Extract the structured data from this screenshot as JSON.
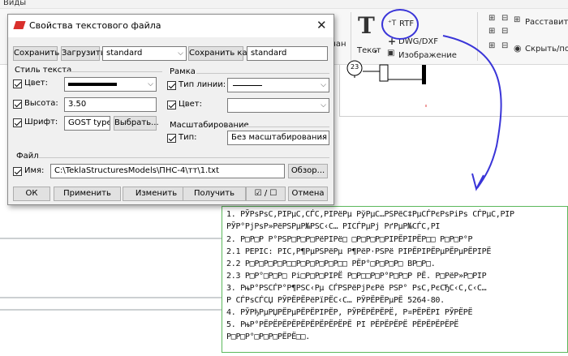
{
  "app": {
    "menu_item": "Виды",
    "ribbon": {
      "text_label_partial": "Текст",
      "chan_label_partial": "чан",
      "rtf_label": "RTF",
      "dwg_label": "DWG/DXF",
      "image_label": "Изображение",
      "arrange_label": "Расставить о",
      "hide_label": "Скрыть/пока",
      "circle_color": "#3a35d8"
    },
    "drawing_label": "23"
  },
  "dialog": {
    "title": "Свойства текстового файла",
    "toolbar": {
      "save_label": "Сохранить",
      "load_label": "Загрузить",
      "preset_value": "standard",
      "save_as_label": "Сохранить как",
      "save_as_value": "standard"
    },
    "text_style": {
      "group_label": "Стиль текста",
      "color_label": "Цвет:",
      "height_label": "Высота:",
      "height_value": "3.50",
      "font_label": "Шрифт:",
      "font_value": "GOST type A",
      "choose_label": "Выбрать..."
    },
    "frame": {
      "group_label": "Рамка",
      "line_type_label": "Тип линии:",
      "color_label": "Цвет:"
    },
    "scaling": {
      "group_label": "Масштабирование",
      "type_label": "Тип:",
      "type_value": "Без масштабирования"
    },
    "file": {
      "group_label": "Файл",
      "name_label": "Имя:",
      "path_value": "C:\\TeklaStructuresModels\\ПНС-4\\тт\\1.txt",
      "browse_label": "Обзор..."
    },
    "buttons": {
      "ok": "ОК",
      "apply": "Применить",
      "modify": "Изменить",
      "get": "Получить",
      "toggle": "☑ / ☐",
      "cancel": "Отмена"
    }
  },
  "text_panel": {
    "lines": [
      "1.  РЎРѕРѕС‚РІРµС‚СЃС‚РІРёРµ РўРµС…РЅРёС‡РµСЃРєРѕРіРѕ СЃРµС‚РІР",
      "    РЎР°РјРѕР»РёРЅРµР№РЅС‹С… РІСЃРµРј РґРµР№СЃС‚РІ",
      "2.  Р□Р□Р Р°РЅР□Р□Р□РёРІРё□ □Р□Р□Р□РІРЁРІРЁР□□ Р□Р□Р°Р",
      "2.1 РЕРІС: РІС‚Р¶РµРЅРёРµ Р¶РёР·РЅРё РІРЁРІРЁРµРЁРµРЁРІРЁ",
      "2.2 Р□Р□Р□Р□Р□□Р□Р□Р□Р□Р□□ РЁР°□Р□Р□Р□ ВР□Р□.",
      "2.3 Р□Р°□Р□Р□ Рі□Р□Р□РІРЁ Р□Р□□Р□Р°Р□Р□Р РЁ. Р□РёР»Р□РІР",
      "3.  РњР°РЅСЃР°Р¶РЅС‹Рµ СЃРЅРёРјРєРё РЅР° РѕС‚РєСЂС‹С‚С‹С…",
      "    Р СЃРѕСЃСЏ РЎРЁРЁРёРїРЁС‹С… РЎРЁРЁРµРЁ 5264-80.",
      "4.  РЎРђРµРЏРЁРµРЁРЁРІРЁР, РЎРЁРЁРЁРЁ, Р¤РЁРЁРІ РЎРЁРЁ",
      "5.  РњР°РЁРЁРЁРЁРЁРЁРЁРЁРЁРЁ РІ РЁРЁРЁРЁ РЁРЁРЁРЁРЁ",
      "    Р□Р□Р°□Р□Р□РЁРЁ□□."
    ],
    "border_color": "#5cb85c"
  }
}
